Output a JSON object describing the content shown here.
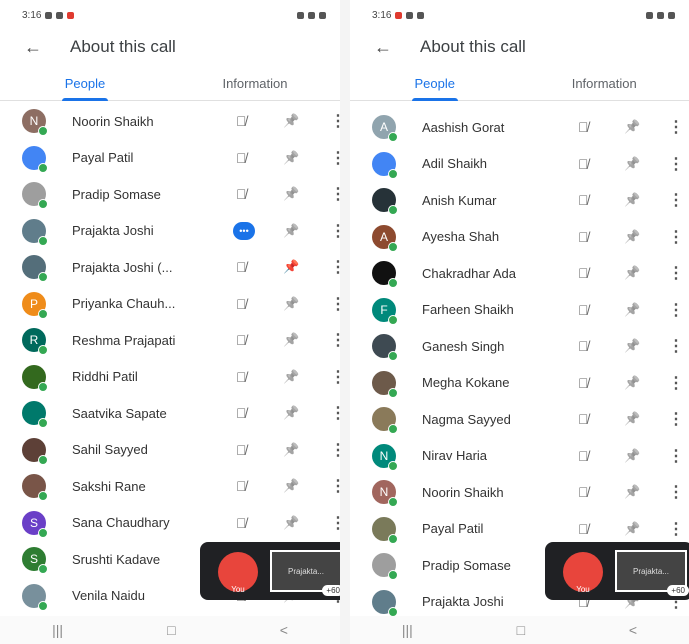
{
  "status_left": {
    "time": "3:16",
    "icons": [
      "sim-icon",
      "mail-icon",
      "red-dot",
      "dot-icon"
    ]
  },
  "status_right": {
    "time": "3:16"
  },
  "header": {
    "title": "About this call",
    "back_icon": "arrow-left-icon"
  },
  "tabs": [
    {
      "label": "People",
      "active": true
    },
    {
      "label": "Information",
      "active": false
    }
  ],
  "left_people": [
    {
      "name": "Noorin Shaikh",
      "initial": "N",
      "color": "#8d6e63",
      "mic": "muted",
      "pin": "pin"
    },
    {
      "name": "Payal Patil",
      "initial": "",
      "color": "#4285f4",
      "mic": "muted",
      "pin": "pin"
    },
    {
      "name": "Pradip Somase",
      "initial": "",
      "color": "#9e9e9e",
      "mic": "muted",
      "pin": "pin"
    },
    {
      "name": "Prajakta Joshi",
      "initial": "",
      "color": "#607d8b",
      "mic": "speaking",
      "pin": "pin"
    },
    {
      "name": "Prajakta Joshi (...",
      "initial": "",
      "color": "#546e7a",
      "mic": "muted",
      "pin": "pinned"
    },
    {
      "name": "Priyanka Chauh...",
      "initial": "P",
      "color": "#ef8c1a",
      "mic": "muted",
      "pin": "pin"
    },
    {
      "name": "Reshma Prajapati",
      "initial": "R",
      "color": "#00695c",
      "mic": "muted",
      "pin": "pin"
    },
    {
      "name": "Riddhi Patil",
      "initial": "",
      "color": "#33691e",
      "mic": "muted",
      "pin": "pin"
    },
    {
      "name": "Saatvika Sapate",
      "initial": "",
      "color": "#00796b",
      "mic": "muted",
      "pin": "pin"
    },
    {
      "name": "Sahil Sayyed",
      "initial": "",
      "color": "#5d4037",
      "mic": "muted",
      "pin": "pin"
    },
    {
      "name": "Sakshi Rane",
      "initial": "",
      "color": "#795548",
      "mic": "muted",
      "pin": "pin"
    },
    {
      "name": "Sana Chaudhary",
      "initial": "S",
      "color": "#6a3fc7",
      "mic": "muted",
      "pin": "pin"
    },
    {
      "name": "Srushti Kadave",
      "initial": "S",
      "color": "#2e7d32",
      "mic": "muted",
      "pin": "pin"
    },
    {
      "name": "Venila Naidu",
      "initial": "",
      "color": "#78909c",
      "mic": "muted",
      "pin": "pin"
    }
  ],
  "right_people": [
    {
      "name": "Aashish Gorat",
      "initial": "A",
      "color": "#90a4ae",
      "mic": "muted",
      "pin": "pin"
    },
    {
      "name": "Adil Shaikh",
      "initial": "",
      "color": "#4285f4",
      "mic": "muted",
      "pin": "pin"
    },
    {
      "name": "Anish Kumar",
      "initial": "",
      "color": "#263238",
      "mic": "muted",
      "pin": "pin"
    },
    {
      "name": "Ayesha Shah",
      "initial": "A",
      "color": "#8d4a2f",
      "mic": "muted",
      "pin": "pin"
    },
    {
      "name": "Chakradhar Ada",
      "initial": "",
      "color": "#111111",
      "mic": "muted",
      "pin": "pin"
    },
    {
      "name": "Farheen Shaikh",
      "initial": "F",
      "color": "#00897b",
      "mic": "muted",
      "pin": "pin"
    },
    {
      "name": "Ganesh Singh",
      "initial": "",
      "color": "#3e4a52",
      "mic": "muted",
      "pin": "pin"
    },
    {
      "name": "Megha Kokane",
      "initial": "",
      "color": "#6d5a4a",
      "mic": "muted",
      "pin": "pin"
    },
    {
      "name": "Nagma Sayyed",
      "initial": "",
      "color": "#8a7a5a",
      "mic": "muted",
      "pin": "pin"
    },
    {
      "name": "Nirav Haria",
      "initial": "N",
      "color": "#00897b",
      "mic": "muted",
      "pin": "pin"
    },
    {
      "name": "Noorin Shaikh",
      "initial": "N",
      "color": "#a1665e",
      "mic": "muted",
      "pin": "pin"
    },
    {
      "name": "Payal Patil",
      "initial": "",
      "color": "#7a7a5a",
      "mic": "muted",
      "pin": "pin"
    },
    {
      "name": "Pradip Somase",
      "initial": "",
      "color": "#9e9e9e",
      "mic": "muted",
      "pin": "pin"
    },
    {
      "name": "Prajakta Joshi",
      "initial": "",
      "color": "#607d8b",
      "mic": "muted",
      "pin": "pin"
    }
  ],
  "pip": {
    "you_label": "You",
    "presenter_label": "Prajakta...",
    "count": "+60"
  },
  "nav": {
    "recents": "|||",
    "home": "□",
    "back": "<"
  }
}
